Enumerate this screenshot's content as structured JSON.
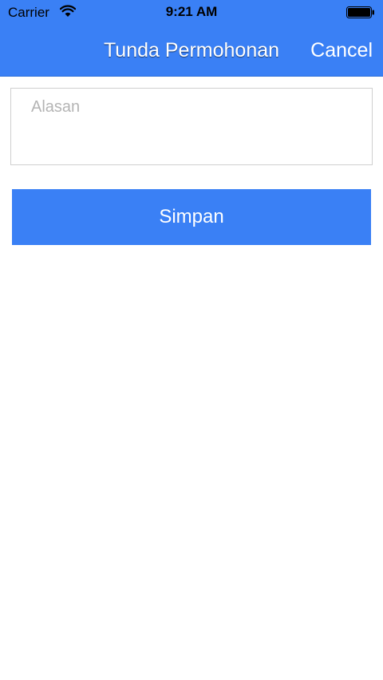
{
  "status_bar": {
    "carrier": "Carrier",
    "time": "9:21 AM",
    "wifi_icon": "wifi-icon",
    "battery_icon": "battery-full-icon"
  },
  "nav": {
    "title": "Tunda Permohonan",
    "cancel_label": "Cancel"
  },
  "form": {
    "reason_placeholder": "Alasan",
    "reason_value": "",
    "save_label": "Simpan"
  },
  "colors": {
    "accent": "#3a80f5",
    "placeholder": "#b4b4b4",
    "border": "#cfcfcf"
  }
}
